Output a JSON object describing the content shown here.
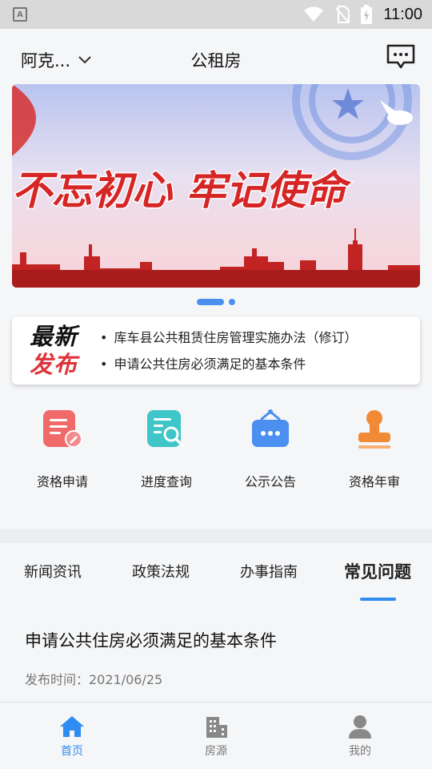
{
  "status_bar": {
    "time": "11:00"
  },
  "header": {
    "city": "阿克...",
    "title": "公租房"
  },
  "banner": {
    "slogan": "不忘初心 牢记使命",
    "dots": 2,
    "active_index": 0
  },
  "news": {
    "logo_line1": "最新",
    "logo_line2": "发布",
    "items": [
      {
        "bullet": "•",
        "text": "库车县公共租赁住房管理实施办法（修订）"
      },
      {
        "bullet": "•",
        "text": "申请公共住房必须满足的基本条件"
      }
    ]
  },
  "quick_links": [
    {
      "label": "资格申请",
      "icon": "application-form-icon",
      "color": "#f06a6a"
    },
    {
      "label": "进度查询",
      "icon": "progress-search-icon",
      "color": "#3ec6c9"
    },
    {
      "label": "公示公告",
      "icon": "announcement-board-icon",
      "color": "#4b8ff0"
    },
    {
      "label": "资格年审",
      "icon": "stamp-icon",
      "color": "#f08a35"
    }
  ],
  "tabs": [
    {
      "label": "新闻资讯",
      "active": false
    },
    {
      "label": "政策法规",
      "active": false
    },
    {
      "label": "办事指南",
      "active": false
    },
    {
      "label": "常见问题",
      "active": true
    }
  ],
  "article": {
    "title": "申请公共住房必须满足的基本条件",
    "date": "发布时间：2021/06/25"
  },
  "bottom_nav": [
    {
      "label": "首页",
      "icon": "home-icon",
      "active": true
    },
    {
      "label": "房源",
      "icon": "building-icon",
      "active": false
    },
    {
      "label": "我的",
      "icon": "user-icon",
      "active": false
    }
  ],
  "colors": {
    "accent": "#2f8cf0",
    "brand_red": "#e0323a"
  }
}
